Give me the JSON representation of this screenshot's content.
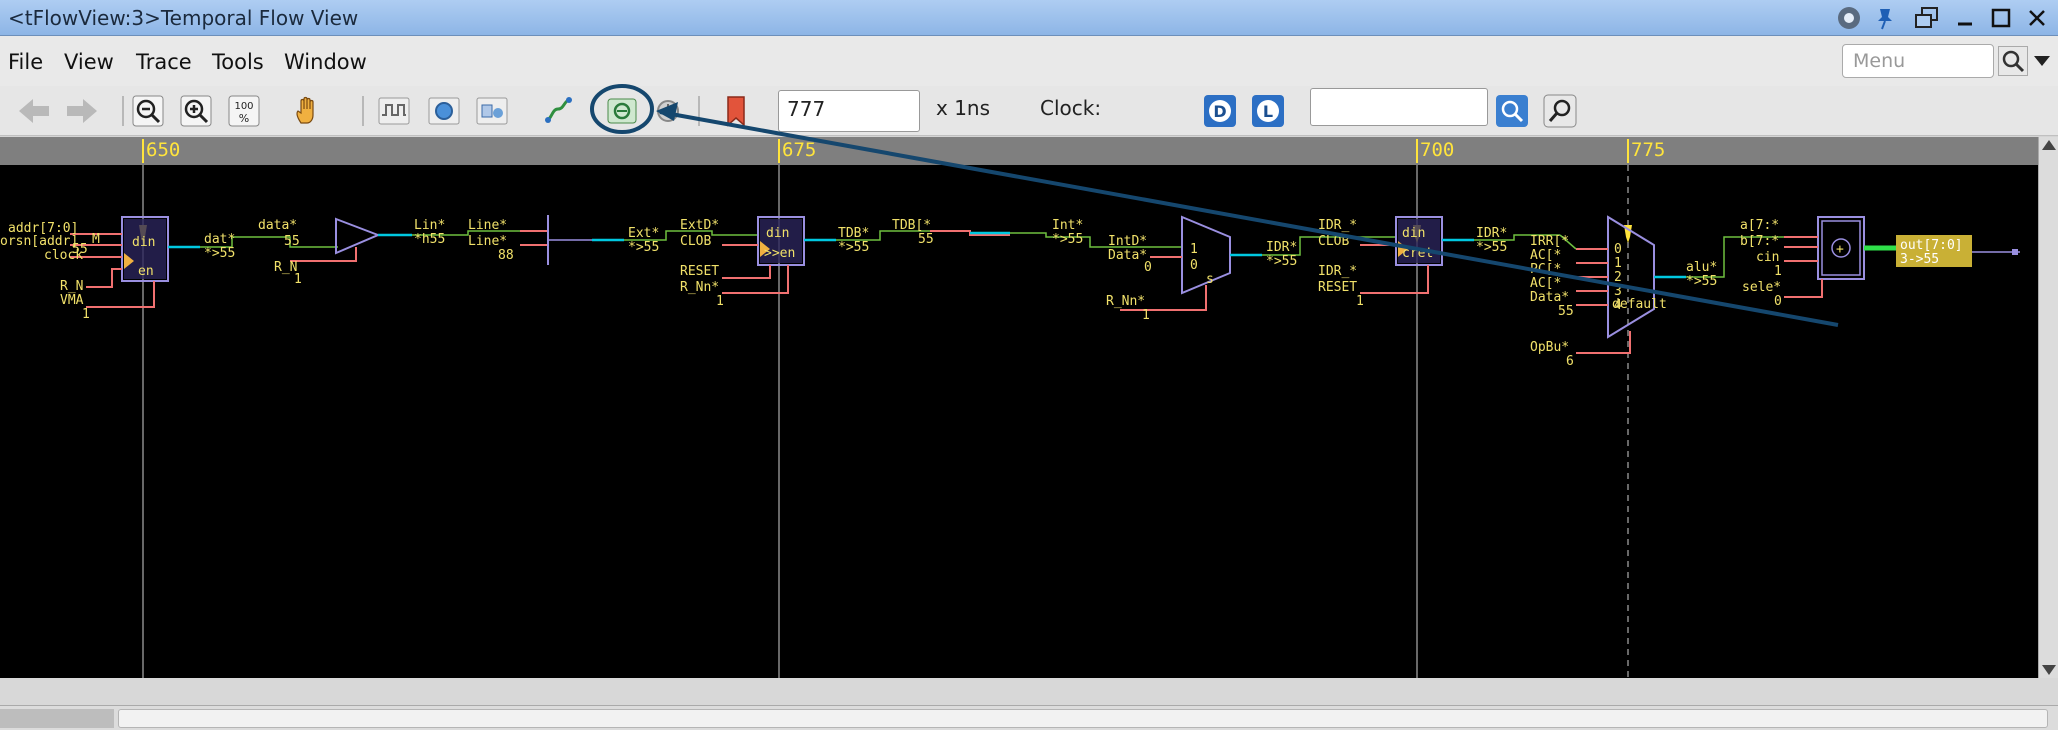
{
  "window": {
    "title": "<tFlowView:3>Temporal Flow View",
    "controls": [
      "settings",
      "pin",
      "restore-down",
      "minimize",
      "maximize",
      "close"
    ]
  },
  "menubar": {
    "items": [
      {
        "label": "File",
        "accel": "F"
      },
      {
        "label": "View",
        "accel": "V"
      },
      {
        "label": "Trace",
        "accel": "T"
      },
      {
        "label": "Tools",
        "accel": "T"
      },
      {
        "label": "Window",
        "accel": "W"
      }
    ],
    "search_placeholder": "Menu"
  },
  "toolbar": {
    "time_value": "777",
    "time_unit": "x 1ns",
    "clock_label": "Clock:",
    "clock_value": "",
    "icons": [
      "back-arrow-icon",
      "forward-arrow-icon",
      "zoom-out-icon",
      "zoom-in-icon",
      "zoom-100-icon",
      "pan-hand-icon",
      "waveform-icon",
      "circle-view-icon",
      "schematic-view-icon",
      "trace-path-icon",
      "highlighted-trace-icon",
      "clock-icon",
      "bookmark-icon",
      "driver-d-icon",
      "load-l-icon",
      "search-icon",
      "find-icon"
    ]
  },
  "ruler": {
    "ticks": [
      {
        "label": "650"
      },
      {
        "label": "675"
      },
      {
        "label": "700"
      },
      {
        "label": "775"
      }
    ]
  },
  "colors": {
    "canvas_bg": "#000000",
    "signal_text": "#f1e16a",
    "wire_cyan": "#00c8e0",
    "wire_red": "#f07070",
    "wire_green": "#6fbf3f",
    "cell_outline": "#9a8fe0",
    "annotation": "#15476e",
    "output_highlight": "#c9b035"
  },
  "schematic": {
    "labels": [
      "addr[7:0]",
      "orsn[addr]",
      "clock",
      "R_N",
      "VMA",
      "1",
      "M",
      "55",
      "din",
      "en",
      "dat*",
      "*>55",
      "data*",
      "55",
      "R_N",
      "1",
      "Lin*",
      "*h55",
      "Line*",
      "Line*",
      "88",
      "Ext*",
      "*>55",
      "ExtD*",
      "CLOB",
      "RESET",
      "R_Nn*",
      "1",
      "din",
      ">>en",
      "TDB*",
      "*>55",
      "TDB[*",
      "55",
      "Int*",
      "*>55",
      "IntD*",
      "Data*",
      "0",
      "1",
      "0",
      "s",
      "R_Nn*",
      "1",
      "IDR*",
      "*>55",
      "IDR_*",
      "CLOB",
      "IDR_*",
      "RESET",
      "1",
      "din",
      "cret",
      "IDR*",
      "*>55",
      "IRR[*",
      "AC[*",
      "PC[*",
      "AC[*",
      "Data*",
      "55",
      "0",
      "1",
      "2",
      "3",
      "4",
      "default",
      "OpBu*",
      "6",
      "alu*",
      "*>55",
      "a[7:*",
      "b[7:*",
      "cin",
      "1",
      "sele*",
      "0",
      "+",
      "out[7:0]",
      "3->55"
    ]
  }
}
